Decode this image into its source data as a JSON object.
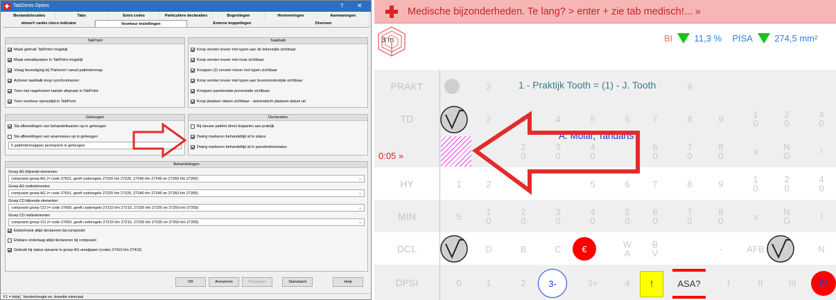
{
  "dialog": {
    "title": "TabDents Opties",
    "help_glyph": "?",
    "close_glyph": "✕",
    "tabs_row1": [
      "Bestandslocaties",
      "Tabs",
      "Extra codes",
      "Particuliere declaraties",
      "Begrotingen",
      "Herinneringen",
      "Aanmaningen"
    ],
    "tabs_row2": [
      "elmex® cariës risico indicator",
      "Voorkeur instellingen",
      "Externe koppelingen",
      "Diversen"
    ],
    "taskpoint": {
      "title": "TabPoint",
      "items": [
        "Maak gebruik TabPoint mogelijk",
        "Maak seinafspraken in TabPoint mogelijk",
        "Vraag bevestiging bij 'Parkeren' vanuit patiëntenmap",
        "Activeer taakbalk knop synchroniseren",
        "Toon niet nagekomen laatste afspraak in TabPoint",
        "Toon voorkeur oproeptijd in TabPoint"
      ]
    },
    "taakbalk": {
      "title": "Taakbalk",
      "items": [
        "Knop venster invoer met typen aan de linkerzijde zichtbaar",
        "Knop venster invoer met muis zichtbaar",
        "Knoppen (2) venster invoer met typen zichtbaar",
        "Knop venster invoer met typen aan boven/onderzijde zichtbaar",
        "Knoppen parodontale presentatie zichtbaar",
        "Knop plaatsen datum zichtbaar - automatisch plaatsen datum uit"
      ]
    },
    "geheugen": {
      "title": "Geheugen",
      "items": [
        {
          "label": "Sla afbeeldingen van behandelkaarten op in geheugen",
          "checked": true
        },
        {
          "label": "Sla afbeeldingen van anamneses op in geheugen",
          "checked": false
        }
      ],
      "combo": "5 patiëntenmappen permanent in geheugen"
    },
    "declaraties": {
      "title": "Declaraties",
      "items": [
        {
          "label": "Bij nieuwe patiënt direct koppelen aan praktijk",
          "checked": false
        },
        {
          "label": "Dwing markeren behandeltijd af in status",
          "checked": true
        },
        {
          "label": "Dwing markeren behandeltijd af in parodontiumstatus",
          "checked": true
        }
      ]
    },
    "behandelingen": {
      "title": "Behandelingen",
      "groups": [
        {
          "label": "Groep AG blijvende elementen",
          "value": "composiet groep AG (= code 27601, geeft coderegels 27220 t/m 27225, 27240 t/m 27245 en 27260 t/m 27265)"
        },
        {
          "label": "Groep AG melkelementen",
          "value": "composiet groep AG (= code 27601, geeft coderegels 27220 t/m 27225, 27240 t/m 27245 en 27260 t/m 27265)"
        },
        {
          "label": "Groep CO blijvende elementen",
          "value": "composiet groep CO (= code 27600, geeft coderegels 27210 t/m 27215, 27230 t/m 27235 en 27250 t/m 27255)"
        },
        {
          "label": "Groep CO melkelementen",
          "value": "composiet groep CO (= code 27600, geeft coderegels 27210 t/m 27215, 27230 t/m 27235 en 27250 t/m 27255)"
        }
      ],
      "checks": [
        {
          "label": "Etstechniek altijd declareren bij composiet",
          "checked": true
        },
        {
          "label": "Etsbare onderlaag altijd declareren bij composiet",
          "checked": false
        },
        {
          "label": "Gebruik bij status opname in groep AG amalgaam (codes 27410 t/m 27415)",
          "checked": true
        }
      ]
    },
    "buttons": {
      "ok": "OK",
      "cancel": "Annuleren",
      "apply": "Toepassen",
      "default": "Standaard",
      "help": "Help"
    },
    "status": {
      "key": "F1 = Help",
      "text": "Vensterhoogte en -breedte minimaal"
    }
  },
  "chart": {
    "banner": "Medische bijzonderheden. Te lang? > enter + zie tab medisch!... »",
    "hex_label": "3 m",
    "bi_label": "BI",
    "bi_value": "11,3 %",
    "pisa_label": "PISA",
    "pisa_value": "274,5 mm²",
    "prakt_text": "1 - Praktijk Tooth = (1) - J. Tooth",
    "dentist": "A. Molar, Tandarts",
    "timer": "0:05 »",
    "rows": [
      "PRAKT",
      "TD",
      "",
      "HY",
      "MIN",
      "DCL",
      "DPSI"
    ],
    "dcl": [
      "D",
      "B",
      "C",
      "€",
      "W\nA",
      "B\nV",
      "-",
      "AFB",
      "N"
    ],
    "dpsi": [
      "0",
      "1",
      "2",
      "3-",
      "3+",
      "4",
      "!",
      "ASA?",
      "I",
      "II",
      "III",
      "IV"
    ]
  },
  "colors": {
    "accent": "#2b6fc0",
    "banner_bg": "#f7b6b6",
    "banner_text": "#c4242a",
    "arrow": "#e32b2b",
    "metric": "#2f7de0",
    "good": "#17c31f"
  }
}
